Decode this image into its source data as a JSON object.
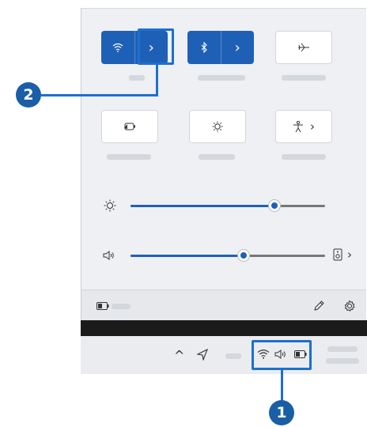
{
  "quick_settings": {
    "wifi_expand_glyph": "›",
    "bluetooth_expand_glyph": "›",
    "accessibility_expand_glyph": "›",
    "cast_expand_glyph": "›"
  },
  "sliders": {
    "brightness_level": 0.74,
    "volume_level": 0.58
  },
  "callouts": {
    "one": "1",
    "two": "2"
  },
  "taskbar": {
    "overflow_glyph": "^"
  },
  "colors": {
    "accent": "#1f60b7",
    "callout_blue": "#1d6fd0",
    "badge_blue": "#1a5ea6"
  }
}
